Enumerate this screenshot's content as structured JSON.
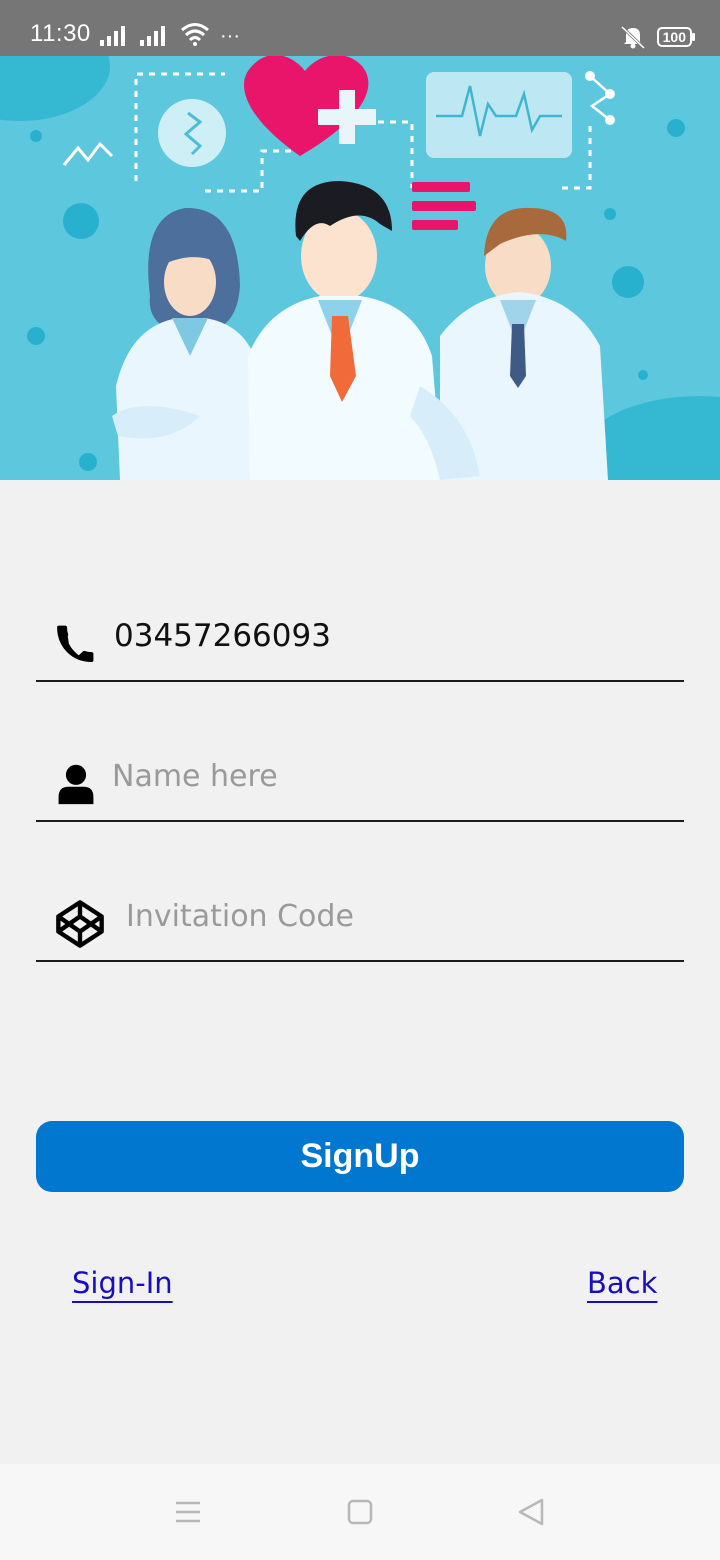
{
  "status_bar": {
    "time": "11:30",
    "extra": "···",
    "battery": "100"
  },
  "hero": {
    "icon": "doctors-illustration"
  },
  "form": {
    "phone": {
      "icon": "phone-icon",
      "value": "03457266093"
    },
    "name": {
      "icon": "user-icon",
      "placeholder": "Name here",
      "value": ""
    },
    "invitation": {
      "icon": "codepen-cube-icon",
      "placeholder": "Invitation Code",
      "value": ""
    }
  },
  "actions": {
    "signup_label": "SignUp",
    "signin_label": "Sign-In",
    "back_label": "Back"
  },
  "colors": {
    "primary": "#0277cf",
    "link": "#1a0dbd",
    "hero_bg": "#5dc7dd",
    "status_bar": "#767676"
  },
  "nav": {
    "items": [
      "menu-icon",
      "home-square-icon",
      "back-triangle-icon"
    ]
  }
}
